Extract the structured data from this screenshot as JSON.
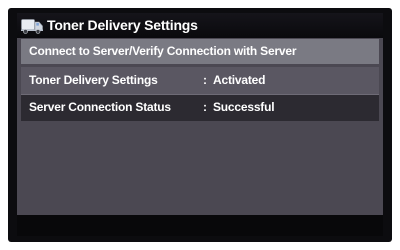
{
  "header": {
    "title": "Toner Delivery Settings",
    "icon": "truck-icon"
  },
  "actions": {
    "connect_label": "Connect to Server/Verify Connection with Server"
  },
  "settings": [
    {
      "label": "Toner Delivery Settings",
      "separator": ":",
      "value": "Activated"
    },
    {
      "label": "Server Connection Status",
      "separator": ":",
      "value": "Successful"
    }
  ],
  "colors": {
    "background": "#4b4852",
    "titlebar": "#0a0a0d",
    "button": "#7a7a83",
    "text": "#ffffff"
  }
}
